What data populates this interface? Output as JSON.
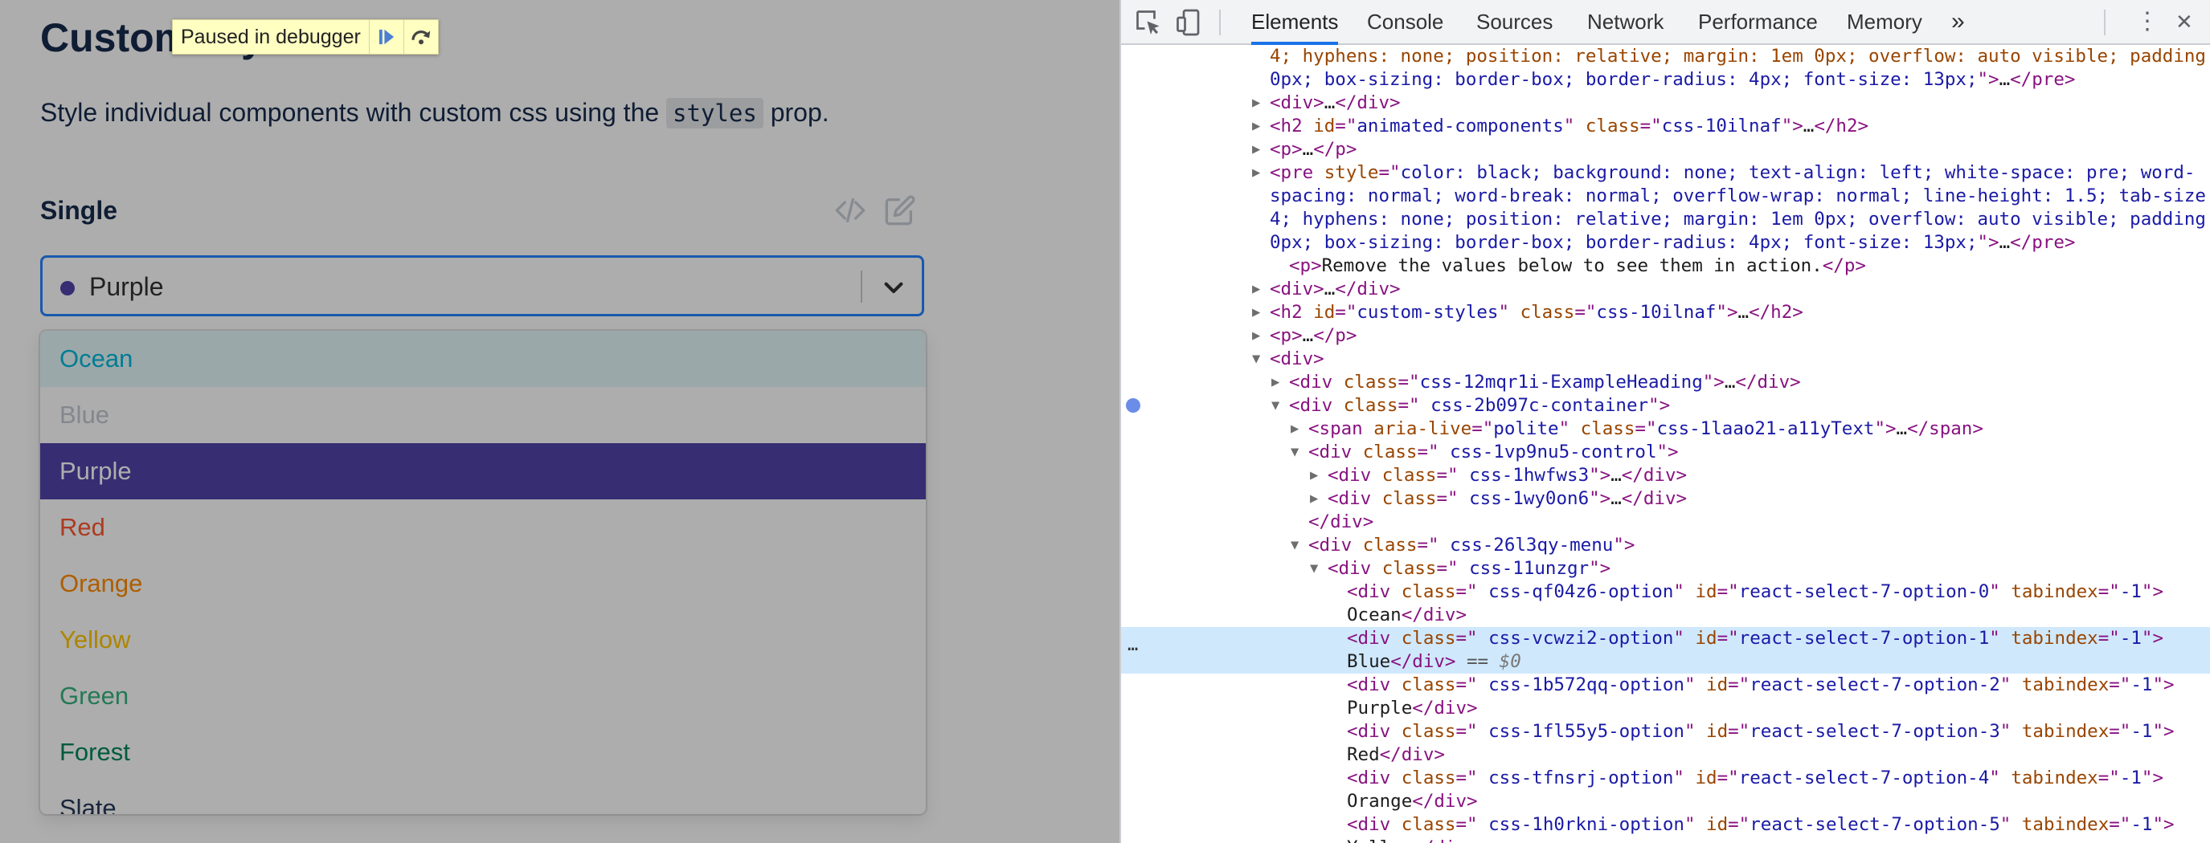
{
  "page": {
    "heading": "Custom Styles",
    "intro_before": "Style individual components with custom css using the ",
    "intro_code": "styles",
    "intro_after": " prop.",
    "section_label": "Single",
    "select_value": "Purple",
    "select_dot_color": "#5243aa",
    "options": [
      {
        "label": "Ocean",
        "color": "#00b8d9",
        "state": "focused"
      },
      {
        "label": "Blue",
        "color": "#c1c7d0",
        "state": "disabled"
      },
      {
        "label": "Purple",
        "color": "#ffffff",
        "state": "selected",
        "bg": "#5243aa"
      },
      {
        "label": "Red",
        "color": "#ff5630",
        "state": "normal"
      },
      {
        "label": "Orange",
        "color": "#ff8b00",
        "state": "normal"
      },
      {
        "label": "Yellow",
        "color": "#ffc400",
        "state": "normal"
      },
      {
        "label": "Green",
        "color": "#36b37e",
        "state": "normal"
      },
      {
        "label": "Forest",
        "color": "#00875a",
        "state": "normal"
      },
      {
        "label": "Slate",
        "color": "#253858",
        "state": "normal"
      }
    ],
    "debugger_text": "Paused in debugger"
  },
  "devtools": {
    "tabs": [
      "Elements",
      "Console",
      "Sources",
      "Network",
      "Performance",
      "Memory"
    ],
    "active_tab": "Elements",
    "more_tabs_glyph": "»",
    "close_glyph": "✕",
    "kebab_glyph": "⋮",
    "lines": [
      {
        "tri": "",
        "indent": 0,
        "html": "<span class='an'>4; hyphens: none; position: relative; margin: 1em 0px; overflow: auto visible; padding:</span>"
      },
      {
        "tri": "",
        "indent": 0,
        "html": "<span class='av'>0px; box-sizing: border-box; border-radius: 4px; font-size: 13px;</span><span class='ag'>\"</span><span class='tg'>&gt;</span>…<span class='tg'>&lt;/pre&gt;</span>"
      },
      {
        "tri": "▶",
        "indent": 0,
        "html": "<span class='tg'>&lt;div&gt;</span>…<span class='tg'>&lt;/div&gt;</span>"
      },
      {
        "tri": "▶",
        "indent": 0,
        "html": "<span class='tg'>&lt;h2 </span><span class='an'>id</span><span class='tg'>=\"</span><span class='av'>animated-components</span><span class='tg'>\" </span><span class='an'>class</span><span class='tg'>=\"</span><span class='av'>css-10ilnaf</span><span class='tg'>\"&gt;</span>…<span class='tg'>&lt;/h2&gt;</span>"
      },
      {
        "tri": "▶",
        "indent": 0,
        "html": "<span class='tg'>&lt;p&gt;</span>…<span class='tg'>&lt;/p&gt;</span>"
      },
      {
        "tri": "▶",
        "indent": 0,
        "html": "<span class='tg'>&lt;pre </span><span class='an'>style</span><span class='tg'>=\"</span><span class='av'>color: black; background: none; text-align: left; white-space: pre; word-</span>"
      },
      {
        "tri": "",
        "indent": 0,
        "html": "<span class='av'>spacing: normal; word-break: normal; overflow-wrap: normal; line-height: 1.5; tab-size:</span>"
      },
      {
        "tri": "",
        "indent": 0,
        "html": "<span class='av'>4; hyphens: none; position: relative; margin: 1em 0px; overflow: auto visible; padding:</span>"
      },
      {
        "tri": "",
        "indent": 0,
        "html": "<span class='av'>0px; box-sizing: border-box; border-radius: 4px; font-size: 13px;</span><span class='tg'>\"&gt;</span>…<span class='tg'>&lt;/pre&gt;</span>"
      },
      {
        "tri": "",
        "indent": 1,
        "html": "<span class='tg'>&lt;p&gt;</span>Remove the values below to see them in action.<span class='tg'>&lt;/p&gt;</span>"
      },
      {
        "tri": "▶",
        "indent": 0,
        "html": "<span class='tg'>&lt;div&gt;</span>…<span class='tg'>&lt;/div&gt;</span>"
      },
      {
        "tri": "▶",
        "indent": 0,
        "html": "<span class='tg'>&lt;h2 </span><span class='an'>id</span><span class='tg'>=\"</span><span class='av'>custom-styles</span><span class='tg'>\" </span><span class='an'>class</span><span class='tg'>=\"</span><span class='av'>css-10ilnaf</span><span class='tg'>\"&gt;</span>…<span class='tg'>&lt;/h2&gt;</span>"
      },
      {
        "tri": "▶",
        "indent": 0,
        "html": "<span class='tg'>&lt;p&gt;</span>…<span class='tg'>&lt;/p&gt;</span>"
      },
      {
        "tri": "▼",
        "indent": 0,
        "html": "<span class='tg'>&lt;div&gt;</span>"
      },
      {
        "tri": "▶",
        "indent": 1,
        "html": "<span class='tg'>&lt;div </span><span class='an'>class</span><span class='tg'>=\"</span><span class='av'>css-12mqr1i-ExampleHeading</span><span class='tg'>\"&gt;</span>…<span class='tg'>&lt;/div&gt;</span>"
      },
      {
        "tri": "▼",
        "indent": 1,
        "html": "<span class='tg'>&lt;div </span><span class='an'>class</span><span class='tg'>=\"</span><span class='av'> css-2b097c-container</span><span class='tg'>\"&gt;</span>"
      },
      {
        "tri": "▶",
        "indent": 2,
        "html": "<span class='tg'>&lt;span </span><span class='an'>aria-live</span><span class='tg'>=\"</span><span class='av'>polite</span><span class='tg'>\" </span><span class='an'>class</span><span class='tg'>=\"</span><span class='av'>css-1laao21-a11yText</span><span class='tg'>\"&gt;</span>…<span class='tg'>&lt;/span&gt;</span>"
      },
      {
        "tri": "▼",
        "indent": 2,
        "html": "<span class='tg'>&lt;div </span><span class='an'>class</span><span class='tg'>=\"</span><span class='av'> css-1vp9nu5-control</span><span class='tg'>\"&gt;</span>"
      },
      {
        "tri": "▶",
        "indent": 3,
        "html": "<span class='tg'>&lt;div </span><span class='an'>class</span><span class='tg'>=\"</span><span class='av'> css-1hwfws3</span><span class='tg'>\"&gt;</span>…<span class='tg'>&lt;/div&gt;</span>"
      },
      {
        "tri": "▶",
        "indent": 3,
        "html": "<span class='tg'>&lt;div </span><span class='an'>class</span><span class='tg'>=\"</span><span class='av'> css-1wy0on6</span><span class='tg'>\"&gt;</span>…<span class='tg'>&lt;/div&gt;</span>"
      },
      {
        "tri": "",
        "indent": 2,
        "html": "<span class='tg'>&lt;/div&gt;</span>"
      },
      {
        "tri": "▼",
        "indent": 2,
        "html": "<span class='tg'>&lt;div </span><span class='an'>class</span><span class='tg'>=\"</span><span class='av'> css-26l3qy-menu</span><span class='tg'>\"&gt;</span>"
      },
      {
        "tri": "▼",
        "indent": 3,
        "html": "<span class='tg'>&lt;div </span><span class='an'>class</span><span class='tg'>=\"</span><span class='av'> css-11unzgr</span><span class='tg'>\"&gt;</span>"
      },
      {
        "tri": "",
        "indent": 4,
        "html": "<span class='tg'>&lt;div </span><span class='an'>class</span><span class='tg'>=\"</span><span class='av'> css-qf04z6-option</span><span class='tg'>\" </span><span class='an'>id</span><span class='tg'>=\"</span><span class='av'>react-select-7-option-0</span><span class='tg'>\" </span><span class='an'>tabindex</span><span class='tg'>=\"</span><span class='av'>-1</span><span class='tg'>\"&gt;</span>"
      },
      {
        "tri": "",
        "indent": 4,
        "html": "Ocean<span class='tg'>&lt;/div&gt;</span>"
      },
      {
        "tri": "",
        "indent": 4,
        "sel": true,
        "html": "<span class='tg'>&lt;div </span><span class='an'>class</span><span class='tg'>=\"</span><span class='av'> css-vcwzi2-option</span><span class='tg'>\" </span><span class='an'>id</span><span class='tg'>=\"</span><span class='av'>react-select-7-option-1</span><span class='tg'>\" </span><span class='an'>tabindex</span><span class='tg'>=\"</span><span class='av'>-1</span><span class='tg'>\"&gt;</span>"
      },
      {
        "tri": "",
        "indent": 4,
        "sel2": true,
        "html": "Blue<span class='tg'>&lt;/div&gt;</span><span class='cm'> == </span><span class='dim'>$0</span>"
      },
      {
        "tri": "",
        "indent": 4,
        "html": "<span class='tg'>&lt;div </span><span class='an'>class</span><span class='tg'>=\"</span><span class='av'> css-1b572qq-option</span><span class='tg'>\" </span><span class='an'>id</span><span class='tg'>=\"</span><span class='av'>react-select-7-option-2</span><span class='tg'>\" </span><span class='an'>tabindex</span><span class='tg'>=\"</span><span class='av'>-1</span><span class='tg'>\"&gt;</span>"
      },
      {
        "tri": "",
        "indent": 4,
        "html": "Purple<span class='tg'>&lt;/div&gt;</span>"
      },
      {
        "tri": "",
        "indent": 4,
        "html": "<span class='tg'>&lt;div </span><span class='an'>class</span><span class='tg'>=\"</span><span class='av'> css-1fl55y5-option</span><span class='tg'>\" </span><span class='an'>id</span><span class='tg'>=\"</span><span class='av'>react-select-7-option-3</span><span class='tg'>\" </span><span class='an'>tabindex</span><span class='tg'>=\"</span><span class='av'>-1</span><span class='tg'>\"&gt;</span>"
      },
      {
        "tri": "",
        "indent": 4,
        "html": "Red<span class='tg'>&lt;/div&gt;</span>"
      },
      {
        "tri": "",
        "indent": 4,
        "html": "<span class='tg'>&lt;div </span><span class='an'>class</span><span class='tg'>=\"</span><span class='av'> css-tfnsrj-option</span><span class='tg'>\" </span><span class='an'>id</span><span class='tg'>=\"</span><span class='av'>react-select-7-option-4</span><span class='tg'>\" </span><span class='an'>tabindex</span><span class='tg'>=\"</span><span class='av'>-1</span><span class='tg'>\"&gt;</span>"
      },
      {
        "tri": "",
        "indent": 4,
        "html": "Orange<span class='tg'>&lt;/div&gt;</span>"
      },
      {
        "tri": "",
        "indent": 4,
        "html": "<span class='tg'>&lt;div </span><span class='an'>class</span><span class='tg'>=\"</span><span class='av'> css-1h0rkni-option</span><span class='tg'>\" </span><span class='an'>id</span><span class='tg'>=\"</span><span class='av'>react-select-7-option-5</span><span class='tg'>\" </span><span class='an'>tabindex</span><span class='tg'>=\"</span><span class='av'>-1</span><span class='tg'>\"&gt;</span>"
      },
      {
        "tri": "",
        "indent": 4,
        "html": "Yellow<span class='tg'>&lt;/div&gt;</span>"
      }
    ]
  }
}
